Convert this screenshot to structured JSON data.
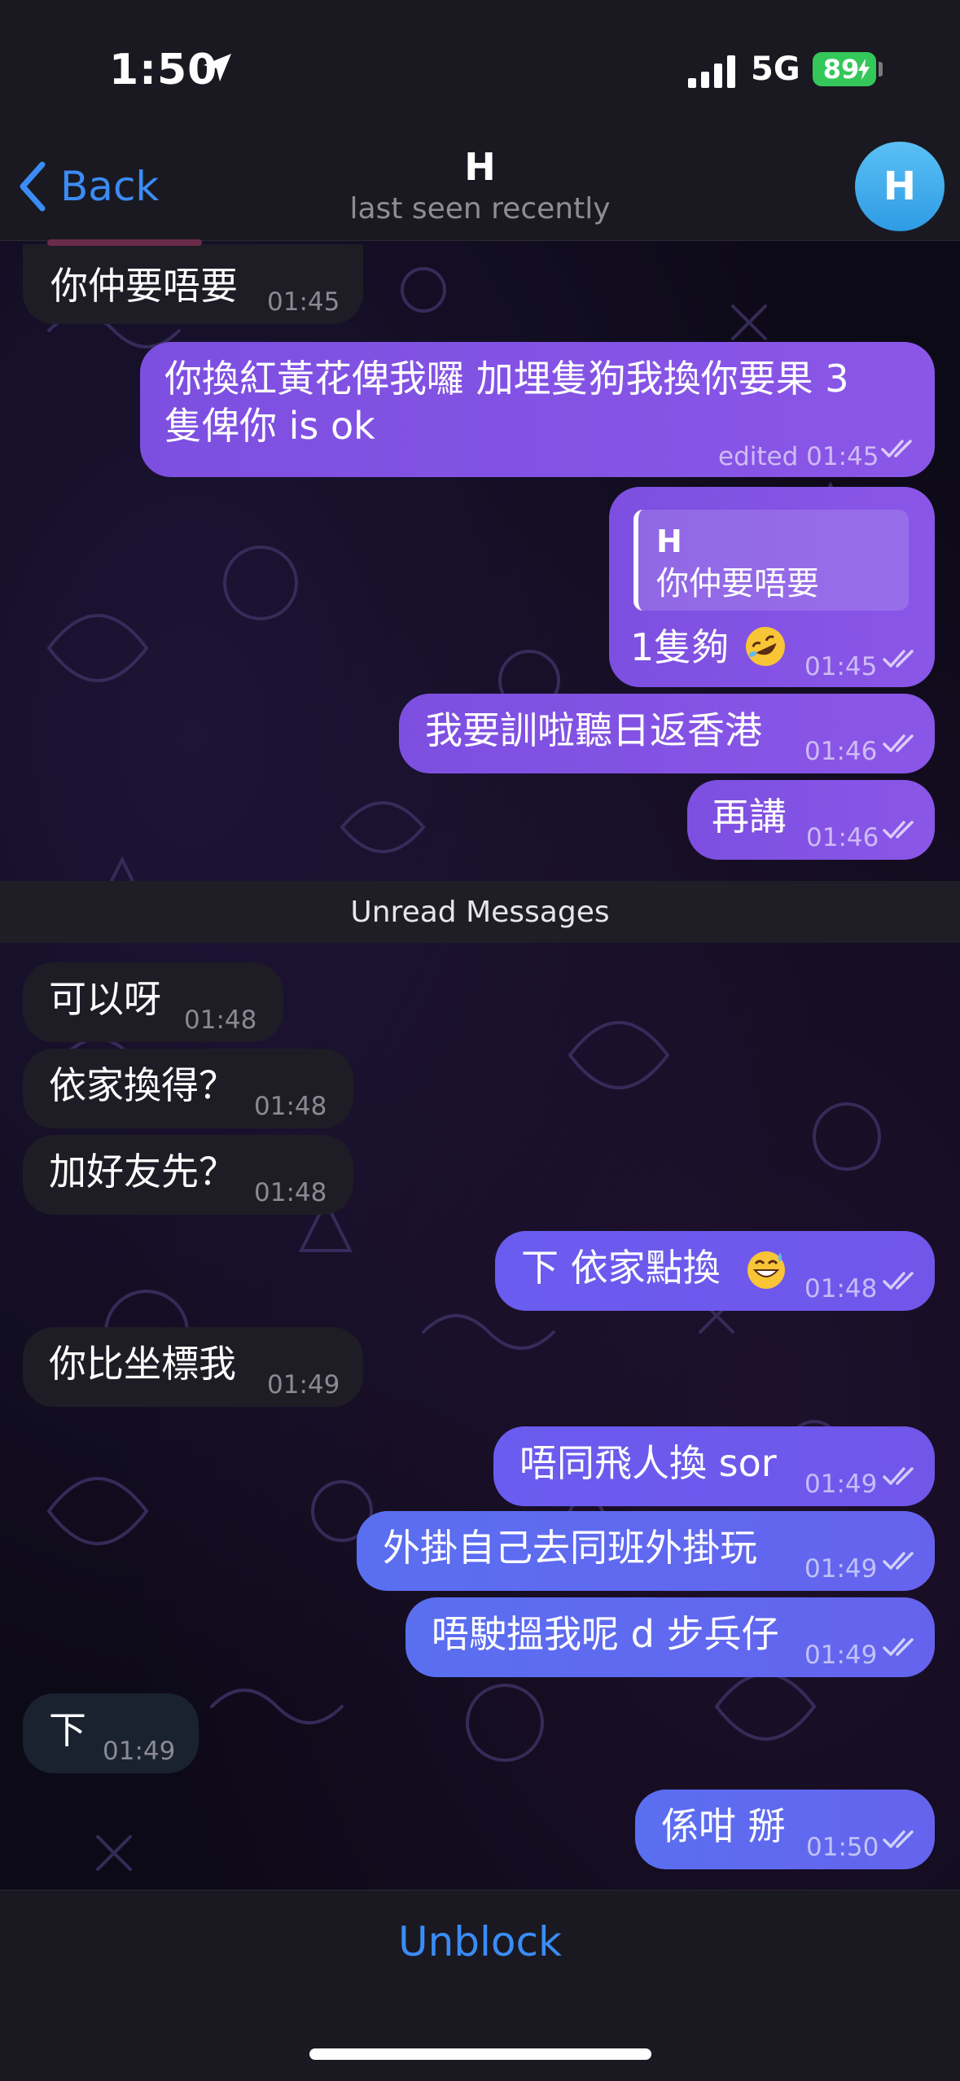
{
  "status_bar": {
    "time": "1:50",
    "network": "5G",
    "battery": "89",
    "battery_color": "#34c759"
  },
  "header": {
    "back_label": "Back",
    "title": "H",
    "subtitle": "last seen recently",
    "avatar_letter": "H",
    "accent_color": "#3b8cf5"
  },
  "unread_label": "Unread Messages",
  "messages": [
    {
      "direction": "in",
      "text": "你仲要唔要",
      "time": "01:45"
    },
    {
      "direction": "out",
      "text_line1": "你換紅黃花俾我囉 加埋隻狗我換你要果 3",
      "text_line2": "隻俾你 is ok",
      "time": "edited 01:45",
      "read": true
    },
    {
      "direction": "out",
      "reply_name": "H",
      "reply_text": "你仲要唔要",
      "text": "1隻夠",
      "emoji": "rolling-on-floor-laughing",
      "time": "01:45",
      "read": true
    },
    {
      "direction": "out",
      "text": "我要訓啦聽日返香港",
      "time": "01:46",
      "read": true
    },
    {
      "direction": "out",
      "text": "再講",
      "time": "01:46",
      "read": true
    },
    {
      "direction": "in",
      "text": "可以呀",
      "time": "01:48"
    },
    {
      "direction": "in",
      "text": "依家換得？",
      "time": "01:48"
    },
    {
      "direction": "in",
      "text": "加好友先？",
      "time": "01:48"
    },
    {
      "direction": "out",
      "text": "下 依家點換",
      "emoji": "grinning-sweat",
      "time": "01:48",
      "read": true
    },
    {
      "direction": "in",
      "text": "你比坐標我",
      "time": "01:49"
    },
    {
      "direction": "out",
      "text": "唔同飛人換 sor",
      "time": "01:49",
      "read": true
    },
    {
      "direction": "out",
      "text": "外掛自己去同班外掛玩",
      "time": "01:49",
      "read": true
    },
    {
      "direction": "out",
      "text": "唔駛搵我呢 d 步兵仔",
      "time": "01:49",
      "read": true
    },
    {
      "direction": "in",
      "text": "下",
      "time": "01:49"
    },
    {
      "direction": "out",
      "text": "係咁 掰",
      "time": "01:50",
      "read": true
    }
  ],
  "bottom": {
    "unblock_label": "Unblock"
  }
}
